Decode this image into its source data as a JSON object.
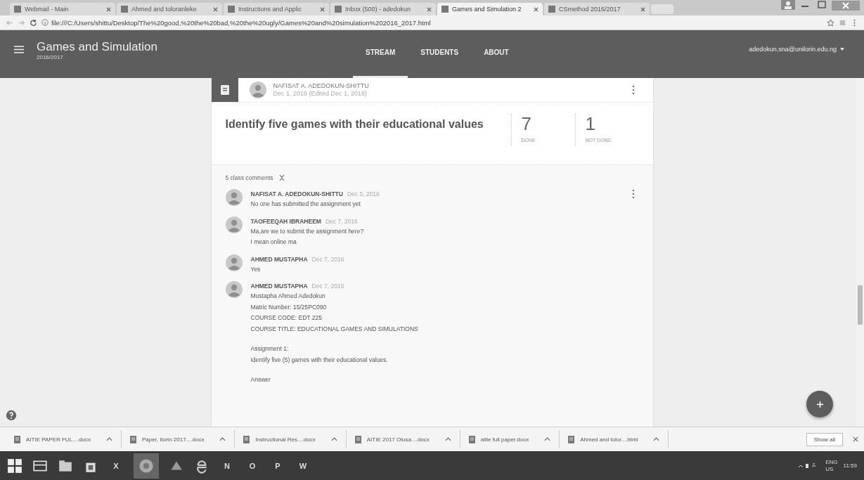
{
  "browser": {
    "tabs": [
      {
        "title": "Webmail - Main",
        "selected": false
      },
      {
        "title": "Ahmed and toloranleke",
        "selected": false
      },
      {
        "title": "Instructions and Applic",
        "selected": false
      },
      {
        "title": "Inbox (500) - adedokun",
        "selected": false
      },
      {
        "title": "Games and Simulation 2",
        "selected": true
      },
      {
        "title": "CSmethod 2016/2017",
        "selected": false
      }
    ],
    "url": "file:///C:/Users/shittu/Desktop/The%20good,%20the%20bad,%20the%20ugly/Games%20and%20simulation%202016_2017.html"
  },
  "app_bar": {
    "title": "Games and Simulation",
    "subtitle": "2016/2017",
    "nav": [
      {
        "label": "STREAM",
        "selected": true
      },
      {
        "label": "STUDENTS",
        "selected": false
      },
      {
        "label": "ABOUT",
        "selected": false
      }
    ],
    "account": "adedokun.sna@unilorin.edu.ng"
  },
  "post": {
    "author": "NAFISAT A. ADEDOKUN-SHITTU",
    "date": "Dec 1, 2016 (Edited Dec 1, 2016)",
    "title": "Identify five games with their educational values",
    "stats": [
      {
        "count": "7",
        "label": "DONE"
      },
      {
        "count": "1",
        "label": "NOT DONE"
      }
    ],
    "comments_count": "5 class comments",
    "comments": [
      {
        "author": "NAFISAT A. ADEDOKUN-SHITTU",
        "date": "Dec 5, 2016",
        "paragraphs": [
          [
            "No one has submitted the assignment yet"
          ]
        ]
      },
      {
        "author": "TAOFEEQAH IBRAHEEM",
        "date": "Dec 7, 2016",
        "paragraphs": [
          [
            "Ma,are we to submit the assignment here?",
            "I mean online ma"
          ]
        ]
      },
      {
        "author": "AHMED MUSTAPHA",
        "date": "Dec 7, 2016",
        "paragraphs": [
          [
            "Yes"
          ]
        ]
      },
      {
        "author": "AHMED MUSTAPHA",
        "date": "Dec 7, 2016",
        "paragraphs": [
          [
            "Mustapha Ahmed Adedokun",
            "Matric Number: 15/25PC090",
            "COURSE CODE: EDT 225",
            "COURSE TITLE: EDUCATIONAL GAMES AND SIMULATIONS"
          ],
          [
            "Assignment 1:",
            "Identify five (5) games with their educational values."
          ],
          [
            "Answer"
          ]
        ]
      }
    ]
  },
  "downloads": {
    "items": [
      "AITIE PAPER FUL....docx",
      "Paper, Ilorin 2017....docx",
      "Instructional Res....docx",
      "AITIE 2017 Olusa....docx",
      "aitie full paper.docx",
      "Ahmed and tolor....html"
    ],
    "show_all": "Show all"
  },
  "taskbar": {
    "apps": [
      "X",
      "N",
      "O",
      "P",
      "W"
    ],
    "language": "ENG",
    "region": "US",
    "time": "11:59"
  }
}
